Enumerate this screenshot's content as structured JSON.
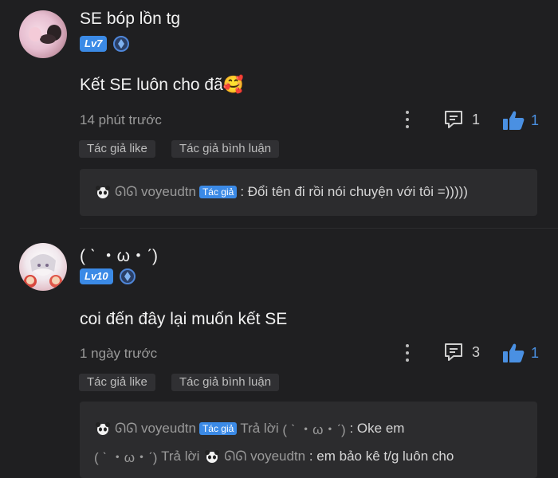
{
  "comments": [
    {
      "username": "SE bóp lồn tg",
      "level": "Lv7",
      "content": "Kết SE luôn cho đã🥰",
      "time": "14 phút trước",
      "reply_count": "1",
      "like_count": "1",
      "tags": [
        "Tác giả like",
        "Tác giả bình luận"
      ],
      "replies": [
        {
          "user": "voyeudtn",
          "badge": "Tác giả",
          "text": ": Đổi tên đi rồi nói chuyện với tôi =)))))"
        }
      ]
    },
    {
      "username": "( ˋ ・ω・ˊ)",
      "level": "Lv10",
      "content": "coi đến đây lại muốn kết SE",
      "time": "1 ngày trước",
      "reply_count": "3",
      "like_count": "1",
      "tags": [
        "Tác giả like",
        "Tác giả bình luận"
      ],
      "replies": [
        {
          "user": "voyeudtn",
          "badge": "Tác giả",
          "reply_word": "Trả lời",
          "target": "( ˋ ・ω・ˊ)",
          "text": ": Oke em"
        },
        {
          "user": "( ˋ ・ω・ˊ)",
          "reply_word": "Trả lời",
          "target": "voyeudtn",
          "text": ": em bảo kê t/g luôn cho"
        }
      ]
    }
  ],
  "icon_user_prefix": "ᘏᘏ",
  "colors": {
    "accent": "#3b8ae6",
    "like": "#4a90e2",
    "bg": "#1f1f21",
    "reply_bg": "#2c2c2e"
  },
  "icons": [
    "more-vertical-icon",
    "comment-icon",
    "thumbs-up-icon",
    "verified-icon",
    "panda-icon"
  ]
}
